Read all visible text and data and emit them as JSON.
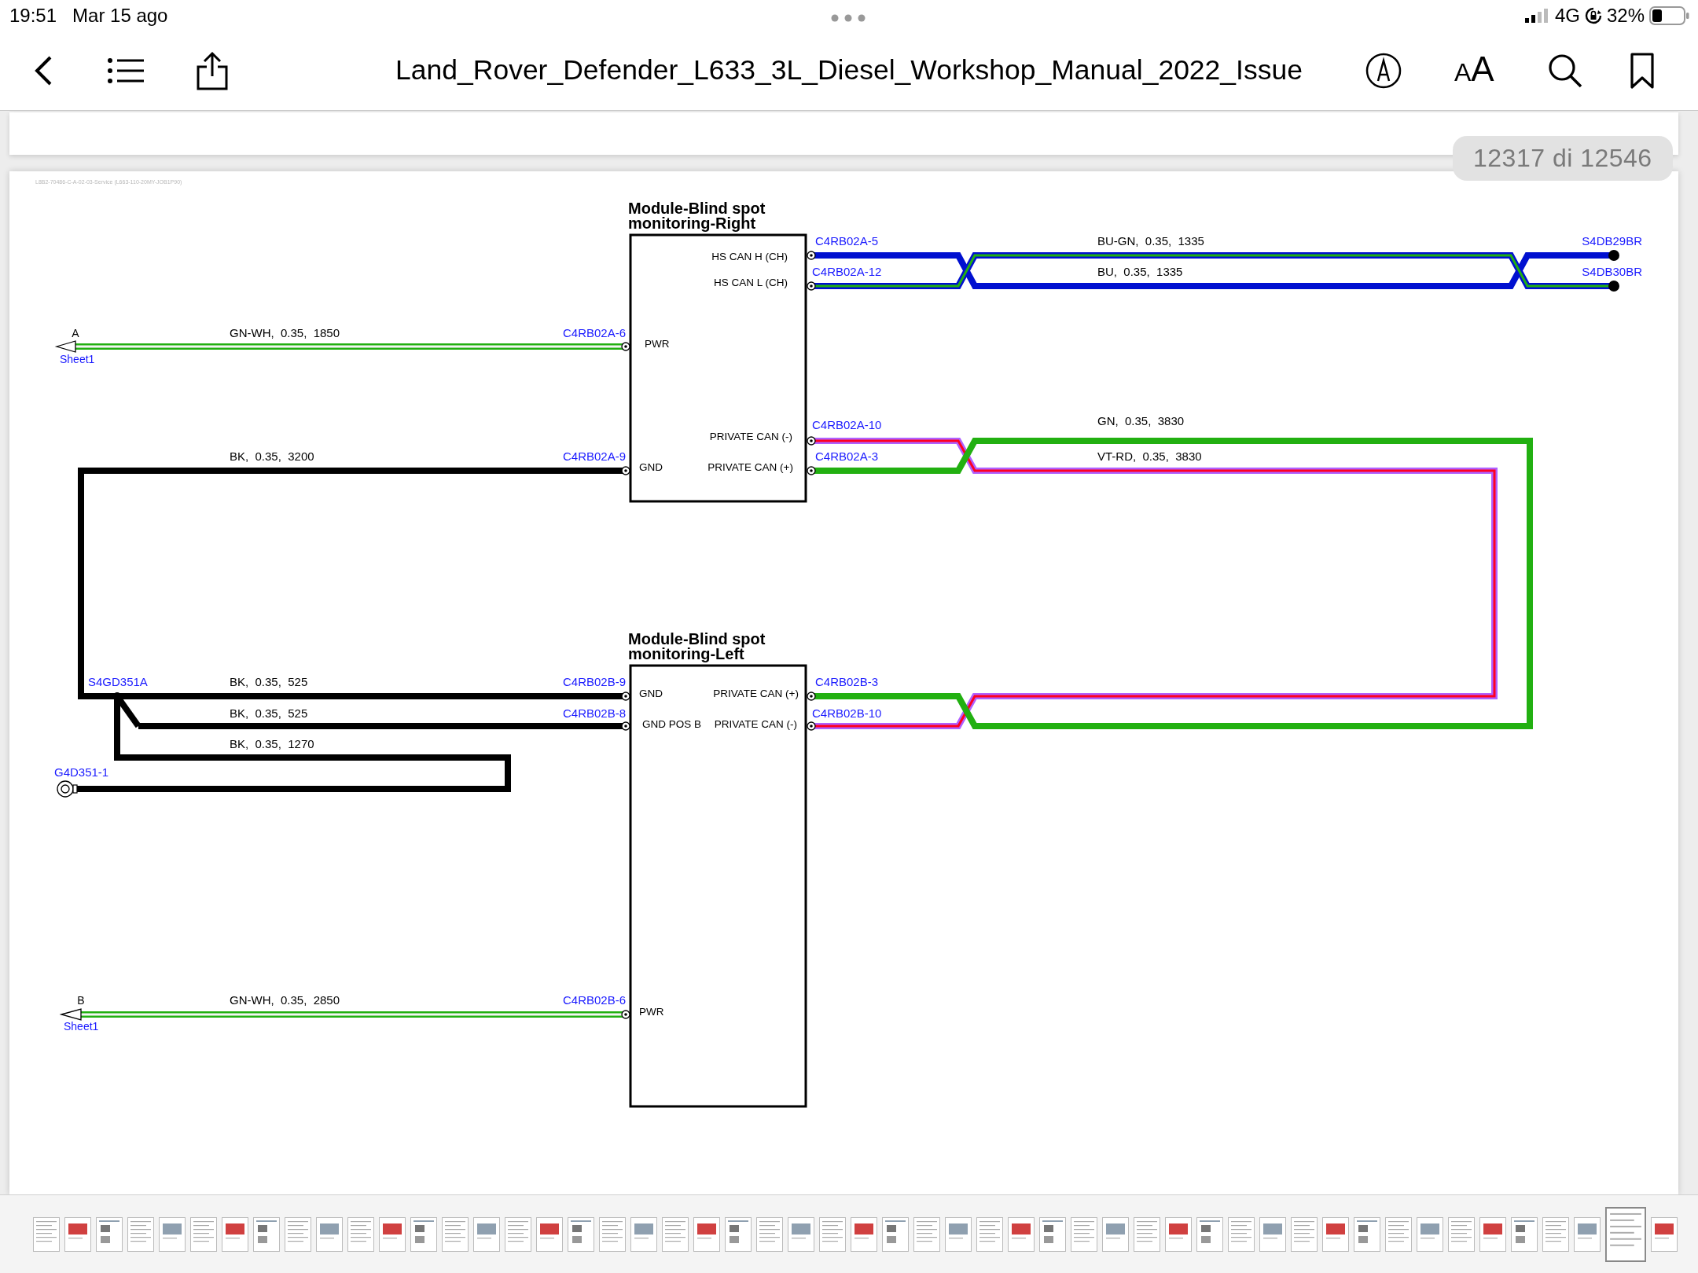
{
  "status_bar": {
    "time": "19:51",
    "date": "Mar 15 ago",
    "network": "4G",
    "battery": "32%"
  },
  "toolbar": {
    "title": "Land_Rover_Defender_L633_3L_Diesel_Workshop_Manual_2022_Issue",
    "font_button": "AA"
  },
  "page_counter": "12317 di 12546",
  "diagram": {
    "header": "L8B2-70486-C-A-02-03-Service (L663-110-20MY-JOB1P90)",
    "modules": [
      {
        "title": "Module-Blind spot monitoring-Right",
        "pins": [
          "HS CAN H (CH)",
          "HS CAN L (CH)",
          "PWR",
          "PRIVATE CAN (-)",
          "GND",
          "PRIVATE CAN (+)"
        ]
      },
      {
        "title": "Module-Blind spot monitoring-Left",
        "pins": [
          "GND",
          "PRIVATE CAN (+)",
          "GND POS B",
          "PRIVATE CAN (-)",
          "PWR"
        ]
      }
    ],
    "connectors": [
      "C4RB02A-5",
      "C4RB02A-12",
      "C4RB02A-6",
      "C4RB02A-10",
      "C4RB02A-9",
      "C4RB02A-3",
      "C4RB02B-9",
      "C4RB02B-3",
      "C4RB02B-8",
      "C4RB02B-10",
      "C4RB02B-6"
    ],
    "wires": [
      {
        "label": "BU-GN,  0.35,  1335",
        "color": "#0010d0",
        "stripe": {
          "color": "#22b011"
        }
      },
      {
        "label": "BU,  0.35,  1335",
        "color": "#0010d0"
      },
      {
        "label": "GN-WH,  0.35,  1850",
        "color": "#22b011",
        "stripe": {
          "color": "#f5f5f5"
        }
      },
      {
        "label": "GN,  0.35,  3830",
        "color": "#22b011"
      },
      {
        "label": "BK,  0.35,  3200",
        "color": "#000000"
      },
      {
        "label": "VT-RD,  0.35,  3830",
        "color": "#b060ff",
        "stripe": {
          "color": "#ff0020"
        }
      },
      {
        "label": "BK,  0.35,  525",
        "color": "#000000"
      },
      {
        "label": "BK,  0.35,  525",
        "color": "#000000"
      },
      {
        "label": "BK,  0.35,  1270",
        "color": "#000000"
      },
      {
        "label": "GN-WH,  0.35,  2850",
        "color": "#22b011",
        "stripe": {
          "color": "#f5f5f5"
        }
      }
    ],
    "splices": [
      "S4DB29BR",
      "S4DB30BR",
      "S4GD351A"
    ],
    "ground": "G4D351-1",
    "off_page": [
      {
        "letter": "A",
        "sheet": "Sheet1"
      },
      {
        "letter": "B",
        "sheet": "Sheet1"
      }
    ]
  },
  "thumbnails": [
    {
      "selected": false
    },
    {
      "selected": false
    },
    {
      "selected": false
    },
    {
      "selected": false
    },
    {
      "selected": false
    },
    {
      "selected": false
    },
    {
      "selected": false
    },
    {
      "selected": false
    },
    {
      "selected": false
    },
    {
      "selected": false
    },
    {
      "selected": false
    },
    {
      "selected": false
    },
    {
      "selected": false
    },
    {
      "selected": false
    },
    {
      "selected": false
    },
    {
      "selected": false
    },
    {
      "selected": false
    },
    {
      "selected": false
    },
    {
      "selected": false
    },
    {
      "selected": false
    },
    {
      "selected": false
    },
    {
      "selected": false
    },
    {
      "selected": false
    },
    {
      "selected": false
    },
    {
      "selected": false
    },
    {
      "selected": false
    },
    {
      "selected": false
    },
    {
      "selected": false
    },
    {
      "selected": false
    },
    {
      "selected": false
    },
    {
      "selected": false
    },
    {
      "selected": false
    },
    {
      "selected": false
    },
    {
      "selected": false
    },
    {
      "selected": false
    },
    {
      "selected": false
    },
    {
      "selected": false
    },
    {
      "selected": false
    },
    {
      "selected": false
    },
    {
      "selected": false
    },
    {
      "selected": false
    },
    {
      "selected": false
    },
    {
      "selected": false
    },
    {
      "selected": false
    },
    {
      "selected": false
    },
    {
      "selected": false
    },
    {
      "selected": false
    },
    {
      "selected": false
    },
    {
      "selected": false
    },
    {
      "selected": false
    },
    {
      "selected": true
    },
    {
      "selected": false
    }
  ]
}
